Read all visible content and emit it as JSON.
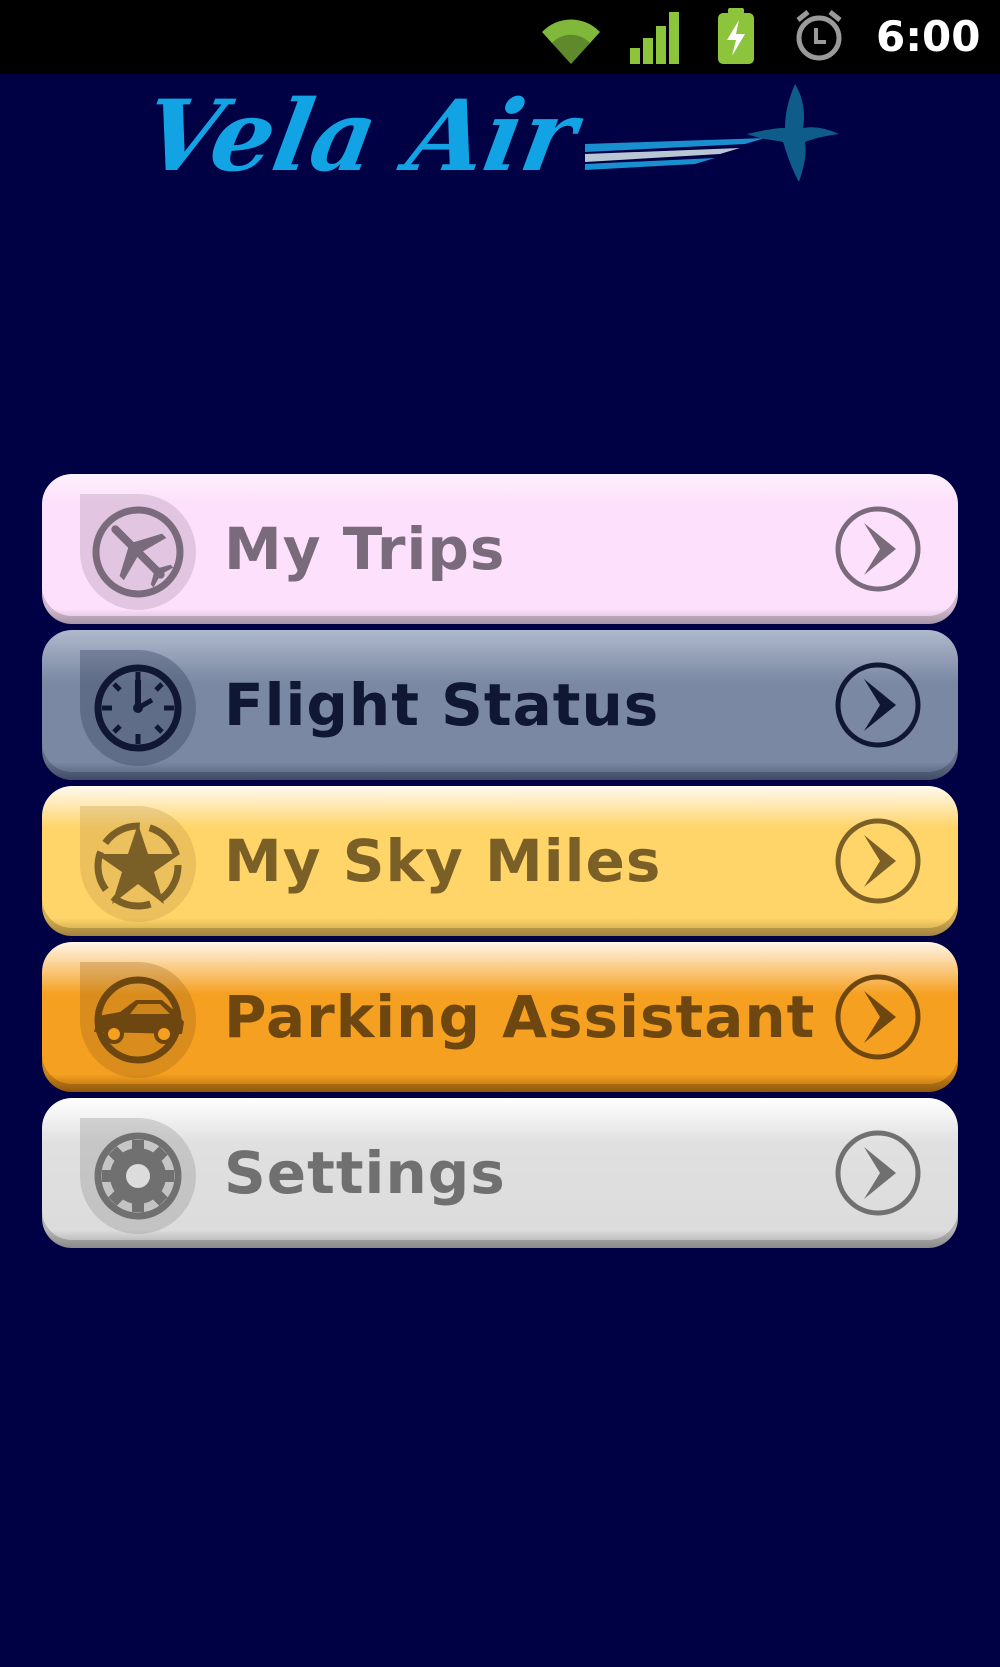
{
  "status_bar": {
    "time": "6:00",
    "icons": [
      "wifi-icon",
      "cell-signal-icon",
      "battery-charging-icon",
      "alarm-icon"
    ]
  },
  "logo": {
    "text": "Vela Air",
    "color": "#11a3e3",
    "bird_color": "#0d5c8a"
  },
  "menu": {
    "items": [
      {
        "label": "My Trips",
        "icon": "airplane-icon",
        "text_color": "#7a6b7c"
      },
      {
        "label": "Flight Status",
        "icon": "clock-icon",
        "text_color": "#0f1733"
      },
      {
        "label": "My Sky Miles",
        "icon": "star-icon",
        "text_color": "#7a6026"
      },
      {
        "label": "Parking Assistant",
        "icon": "car-icon",
        "text_color": "#6e4710"
      },
      {
        "label": "Settings",
        "icon": "gear-icon",
        "text_color": "#707070"
      }
    ]
  },
  "colors": {
    "background": "#000044",
    "status_bar": "#000000",
    "accent_green": "#8cc43c"
  }
}
